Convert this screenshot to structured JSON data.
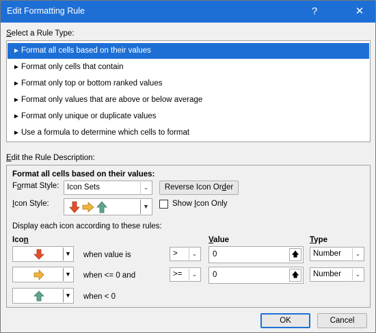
{
  "window": {
    "title": "Edit Formatting Rule",
    "help_glyph": "?",
    "close_glyph": "✕"
  },
  "rule_type": {
    "label_prefix": "S",
    "label_rest": "elect a Rule Type:",
    "items": [
      {
        "label": "Format all cells based on their values",
        "selected": true
      },
      {
        "label": "Format only cells that contain",
        "selected": false
      },
      {
        "label": "Format only top or bottom ranked values",
        "selected": false
      },
      {
        "label": "Format only values that are above or below average",
        "selected": false
      },
      {
        "label": "Format only unique or duplicate values",
        "selected": false
      },
      {
        "label": "Use a formula to determine which cells to format",
        "selected": false
      }
    ]
  },
  "description": {
    "label_prefix": "E",
    "label_rest": "dit the Rule Description:",
    "heading": "Format all cells based on their values:",
    "format_style_label_pre": "F",
    "format_style_label_u": "o",
    "format_style_label_post": "rmat Style:",
    "format_style_value": "Icon Sets",
    "reverse_button_pre": "Reverse Icon Or",
    "reverse_button_u": "d",
    "reverse_button_post": "er",
    "icon_style_label_pre": "",
    "icon_style_label_u": "I",
    "icon_style_label_post": "con Style:",
    "show_icon_only_pre": "Show ",
    "show_icon_only_u": "I",
    "show_icon_only_post": "con Only",
    "show_icon_only_checked": false,
    "rules_caption": "Display each icon according to these rules:",
    "col_icon_pre": "Ico",
    "col_icon_u": "n",
    "col_value_u": "V",
    "col_value_post": "alue",
    "col_type_u": "T",
    "col_type_post": "ype",
    "rows": [
      {
        "icon": "red-down-arrow",
        "condition": "when value is",
        "operator": ">",
        "value": "0",
        "type": "Number",
        "has_inputs": true
      },
      {
        "icon": "yellow-right-arrow",
        "condition": "when <= 0 and",
        "operator": ">=",
        "value": "0",
        "type": "Number",
        "has_inputs": true
      },
      {
        "icon": "green-up-arrow",
        "condition": "when < 0",
        "operator": "",
        "value": "",
        "type": "",
        "has_inputs": false
      }
    ]
  },
  "footer": {
    "ok_label": "OK",
    "cancel_label": "Cancel"
  },
  "colors": {
    "accent": "#1d6fd6",
    "arrow_red": "#e0502a",
    "arrow_yellow": "#f0b43c",
    "arrow_green": "#5fa58a"
  }
}
